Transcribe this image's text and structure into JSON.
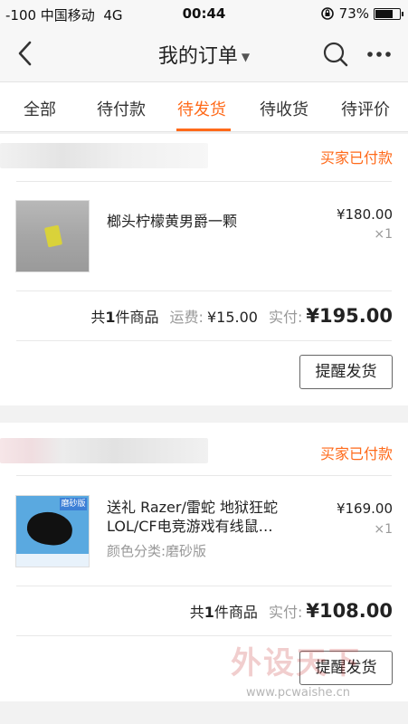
{
  "status_bar": {
    "carrier": "-100 中国移动",
    "network": "4G",
    "time": "00:44",
    "battery": "73%",
    "battery_level": 0.73
  },
  "nav": {
    "title": "我的订单",
    "caret": "▼"
  },
  "tabs": [
    "全部",
    "待付款",
    "待发货",
    "待收货",
    "待评价"
  ],
  "active_tab": 2,
  "orders": [
    {
      "status": "买家已付款",
      "item": {
        "title": "榔头柠檬黄男爵一颗",
        "sku": "",
        "price": "¥180.00",
        "qty": "×1"
      },
      "summary": {
        "count_prefix": "共",
        "count": "1",
        "count_suffix": " 件商品",
        "shipping_label": "运费:",
        "shipping_value": "¥15.00",
        "paid_label": "实付:",
        "paid_value": "¥195.00"
      },
      "button": "提醒发货"
    },
    {
      "status": "买家已付款",
      "item": {
        "title": "送礼 Razer/雷蛇 地狱狂蛇 LOL/CF电竞游戏有线鼠…",
        "sku": "颜色分类:磨砂版",
        "price": "¥169.00",
        "qty": "×1",
        "thumb_tag": "磨砂版"
      },
      "summary": {
        "count_prefix": "共",
        "count": "1",
        "count_suffix": " 件商品",
        "paid_label": "实付:",
        "paid_value": "¥108.00"
      },
      "button": "提醒发货"
    }
  ],
  "watermark": {
    "text": "外设天下",
    "url": "www.pcwaishe.cn"
  },
  "colors": {
    "accent": "#ff6a1a",
    "background": "#f2f2f2"
  }
}
